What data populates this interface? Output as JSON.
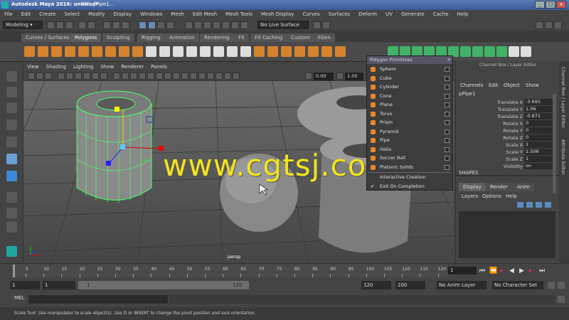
{
  "window": {
    "title": "Autodesk Maya 2016: untitled*",
    "separator": "---",
    "selection_title": "pPipe1..."
  },
  "menubar": [
    "File",
    "Edit",
    "Create",
    "Select",
    "Modify",
    "Display",
    "Windows",
    "Mesh",
    "Edit Mesh",
    "Mesh Tools",
    "Mesh Display",
    "Curves",
    "Surfaces",
    "Deform",
    "UV",
    "Generate",
    "Cache",
    "Help"
  ],
  "status_line": {
    "menu_set": "Modeling",
    "live_surface": "No Live Surface"
  },
  "shelf_tabs": [
    "Curves / Surfaces",
    "Polygons",
    "Sculpting",
    "Rigging",
    "Animation",
    "Rendering",
    "FX",
    "FX Caching",
    "Custom",
    "XGen"
  ],
  "active_shelf": "Polygons",
  "viewport_menu": [
    "View",
    "Shading",
    "Lighting",
    "Show",
    "Renderer",
    "Panels"
  ],
  "viewport_fields": {
    "exposure": "0.00",
    "gamma": "1.00"
  },
  "viewport_label": "persp",
  "watermark": "www.cgtsj.com",
  "popup": {
    "title": "Polygon Primitives",
    "items": [
      "Sphere",
      "Cube",
      "Cylinder",
      "Cone",
      "Plane",
      "Torus",
      "Prism",
      "Pyramid",
      "Pipe",
      "Helix",
      "Soccer Ball",
      "Platonic Solids"
    ],
    "options": [
      {
        "label": "Interactive Creation",
        "checked": false
      },
      {
        "label": "Exit On Completion",
        "checked": true
      }
    ]
  },
  "channel_box": {
    "header": "Channel Box / Layer Editor",
    "menu": [
      "Channels",
      "Edit",
      "Object",
      "Show"
    ],
    "object": "pPipe1",
    "attributes": [
      {
        "name": "Translate X",
        "value": "-3.695"
      },
      {
        "name": "Translate Y",
        "value": "1.06"
      },
      {
        "name": "Translate Z",
        "value": "-0.671"
      },
      {
        "name": "Rotate X",
        "value": "0"
      },
      {
        "name": "Rotate Y",
        "value": "0"
      },
      {
        "name": "Rotate Z",
        "value": "0"
      },
      {
        "name": "Scale X",
        "value": "1"
      },
      {
        "name": "Scale Y",
        "value": "2.506"
      },
      {
        "name": "Scale Z",
        "value": "1"
      },
      {
        "name": "Visibility",
        "value": "on"
      }
    ],
    "shapes_label": "SHAPES",
    "layer_tabs": [
      "Display",
      "Render",
      "Anim"
    ],
    "layer_menu": [
      "Layers",
      "Options",
      "Help"
    ],
    "side_tabs": [
      "Channel Box / Layer Editor",
      "Attribute Editor"
    ]
  },
  "time_slider": {
    "ticks": [
      "5",
      "10",
      "15",
      "20",
      "25",
      "30",
      "35",
      "40",
      "45",
      "50",
      "55",
      "60",
      "65",
      "70",
      "75",
      "80",
      "85",
      "90",
      "95",
      "100",
      "105",
      "110",
      "115",
      "120"
    ],
    "current_frame": "1"
  },
  "range_slider": {
    "start": "1",
    "playback_start": "1",
    "range_start_label": "1",
    "range_end_label": "120",
    "playback_end": "120",
    "end": "200",
    "anim_layer": "No Anim Layer",
    "character_set": "No Character Set"
  },
  "command_line": {
    "label": "MEL"
  },
  "help_line": "Scale Tool: Use manipulator to scale object(s). Use D or INSERT to change the pivot position and axis orientation."
}
